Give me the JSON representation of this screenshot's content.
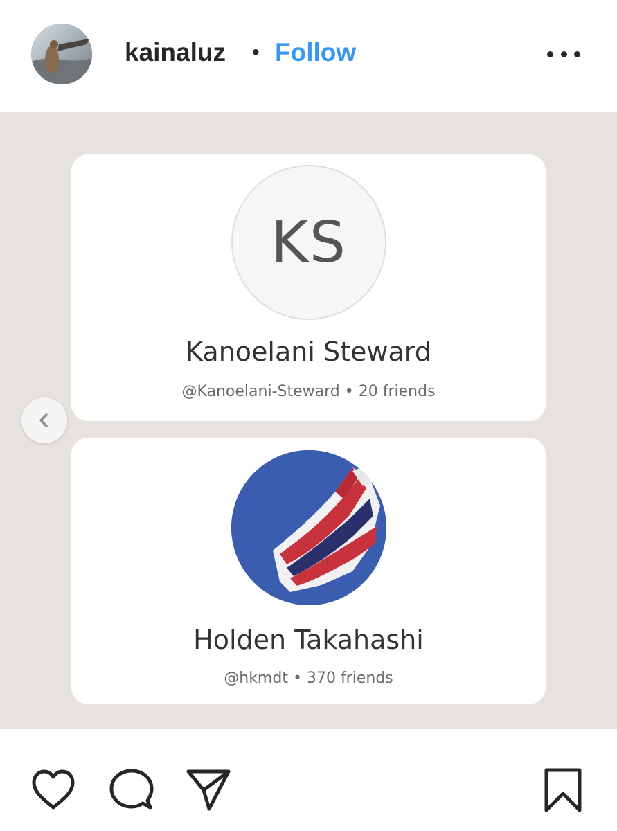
{
  "header": {
    "username": "kainaluz",
    "separator": "•",
    "follow_label": "Follow",
    "avatar_icon": "profile-photo-surf",
    "more_icon": "more-horizontal-icon"
  },
  "post": {
    "cards": [
      {
        "initials": "KS",
        "name": "Kanoelani Steward",
        "handle": "@Kanoelani-Steward",
        "meta_separator": "•",
        "friends": "20 friends"
      },
      {
        "initials": "",
        "name": "Holden Takahashi",
        "handle": "@hkmdt",
        "meta_separator": "•",
        "friends": "370 friends",
        "photo": "hawaiian-flag-photo"
      }
    ],
    "carousel_prev_icon": "chevron-left-icon"
  },
  "actions": {
    "like_icon": "heart-icon",
    "comment_icon": "comment-icon",
    "share_icon": "paper-plane-icon",
    "save_icon": "bookmark-icon"
  },
  "colors": {
    "follow": "#3897f0",
    "post_background": "#e6e3de",
    "text": "#262626"
  }
}
